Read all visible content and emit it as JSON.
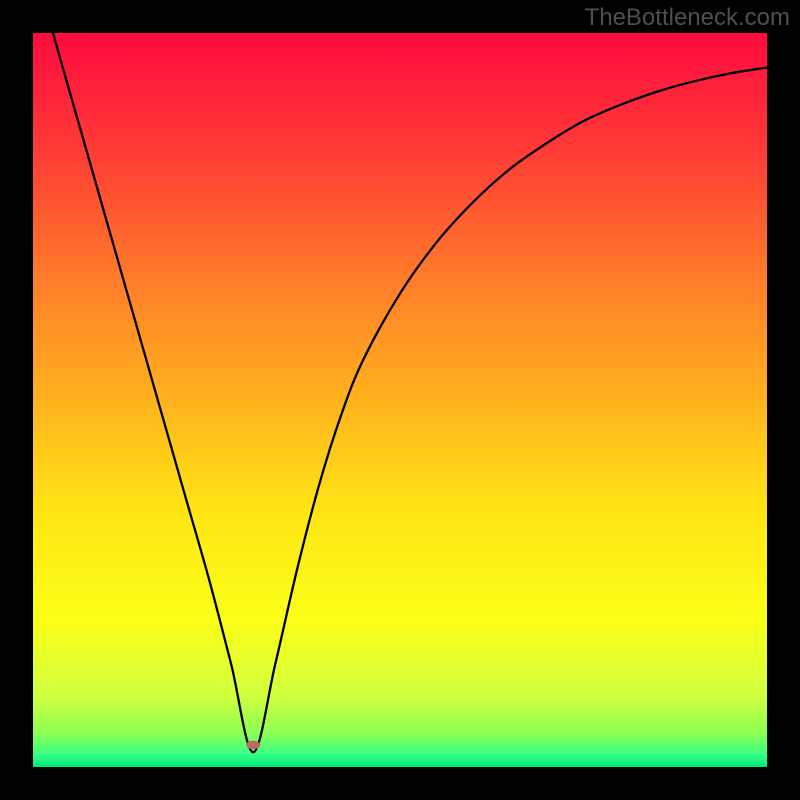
{
  "watermark": "TheBottleneck.com",
  "chart_data": {
    "type": "line",
    "title": "",
    "xlabel": "",
    "ylabel": "",
    "xlim": [
      0,
      100
    ],
    "ylim": [
      0,
      100
    ],
    "gradient_stops": [
      {
        "offset": 0,
        "color": "#ff0b3f"
      },
      {
        "offset": 0.16,
        "color": "#ff3b36"
      },
      {
        "offset": 0.33,
        "color": "#ff7a2a"
      },
      {
        "offset": 0.5,
        "color": "#ffb31e"
      },
      {
        "offset": 0.66,
        "color": "#ffe714"
      },
      {
        "offset": 0.8,
        "color": "#fbff18"
      },
      {
        "offset": 0.9,
        "color": "#d4ff3d"
      },
      {
        "offset": 0.955,
        "color": "#8bff55"
      },
      {
        "offset": 0.985,
        "color": "#2fff88"
      },
      {
        "offset": 1.0,
        "color": "#00e876"
      }
    ],
    "curve": {
      "min_x": 30,
      "min_y": 2,
      "x": [
        0,
        3,
        6,
        9,
        12,
        15,
        18,
        21,
        24,
        27,
        30,
        33,
        36,
        39,
        42,
        45,
        50,
        55,
        60,
        65,
        70,
        75,
        80,
        85,
        90,
        95,
        100
      ],
      "y": [
        110,
        99,
        88.5,
        78,
        67.5,
        57,
        46.5,
        36,
        25.5,
        14,
        2,
        14,
        27,
        38.5,
        48,
        55.5,
        64.5,
        71.5,
        77,
        81.5,
        85,
        88,
        90.2,
        92,
        93.4,
        94.5,
        95.3
      ]
    },
    "marker": {
      "x": 30,
      "y": 3,
      "rx": 7,
      "ry": 4.2,
      "fill": "#c1695e"
    }
  }
}
